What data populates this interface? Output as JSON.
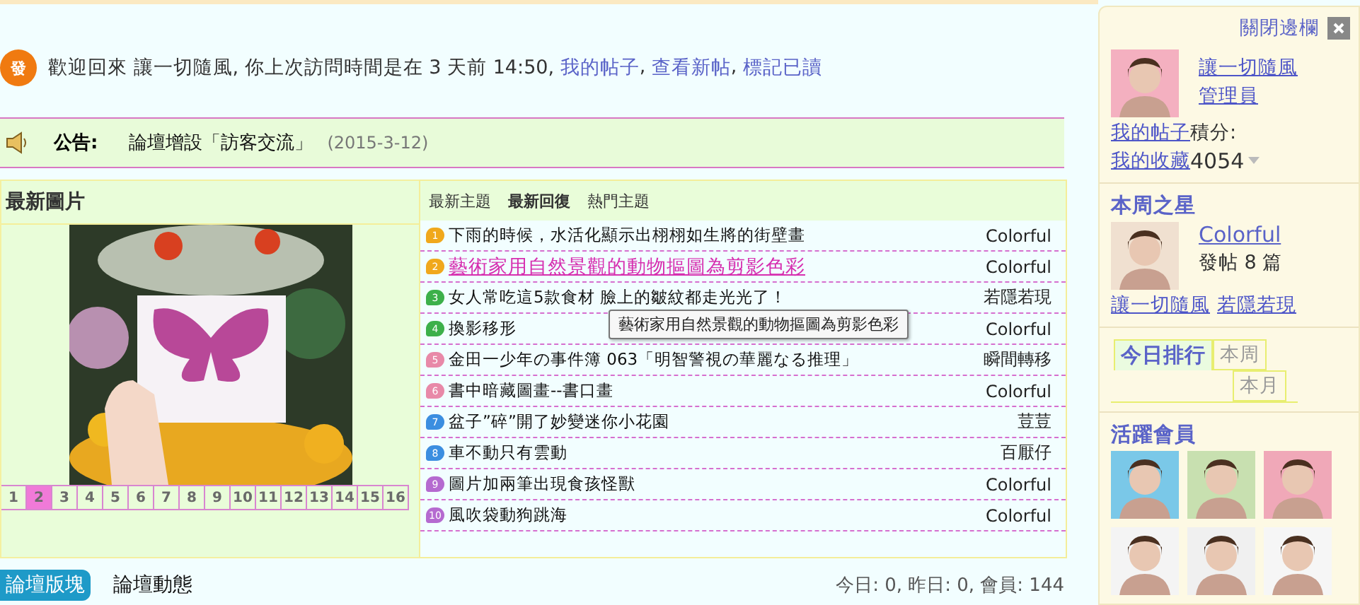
{
  "welcome": {
    "badge": "發",
    "text": "歡迎回來 讓一切隨風, 你上次訪問時間是在 3 天前 14:50, ",
    "links": [
      "我的帖子",
      "查看新帖",
      "標記已讀"
    ],
    "separator": ", "
  },
  "announcement": {
    "label": "公告:",
    "text": "論壇增設「訪客交流」",
    "date": "(2015-3-12)"
  },
  "latest_images": {
    "title": "最新圖片",
    "pages": [
      {
        "label": "1",
        "selected": false
      },
      {
        "label": "2",
        "selected": true
      },
      {
        "label": "3",
        "selected": false
      },
      {
        "label": "4",
        "selected": false
      },
      {
        "label": "5",
        "selected": false
      },
      {
        "label": "6",
        "selected": false
      },
      {
        "label": "7",
        "selected": false
      },
      {
        "label": "8",
        "selected": false
      },
      {
        "label": "9",
        "selected": false
      },
      {
        "label": "10",
        "selected": false
      },
      {
        "label": "11",
        "selected": false
      },
      {
        "label": "12",
        "selected": false
      },
      {
        "label": "13",
        "selected": false
      },
      {
        "label": "14",
        "selected": false
      },
      {
        "label": "15",
        "selected": false
      },
      {
        "label": "16",
        "selected": false
      }
    ]
  },
  "topics": {
    "tabs": [
      {
        "label": "最新主題",
        "selected": false
      },
      {
        "label": "最新回復",
        "selected": true
      },
      {
        "label": "熱門主題",
        "selected": false
      }
    ],
    "rows": [
      {
        "rank": "1",
        "color": "#f0a81c",
        "title": "下雨的時候，水活化顯示出栩栩如生將的街壁畫",
        "author": "Colorful",
        "highlighted": false
      },
      {
        "rank": "2",
        "color": "#f0a81c",
        "title": "藝術家用自然景觀的動物摳圖為剪影色彩",
        "author": "Colorful",
        "highlighted": true
      },
      {
        "rank": "3",
        "color": "#3cb04a",
        "title": "女人常吃這5款食材 臉上的皺紋都走光光了！",
        "author": "若隱若現",
        "highlighted": false
      },
      {
        "rank": "4",
        "color": "#3cb04a",
        "title": "換影移形",
        "author": "Colorful",
        "highlighted": false
      },
      {
        "rank": "5",
        "color": "#e889a8",
        "title": "金田一少年の事件簿 063「明智警視の華麗なる推理」",
        "author": "瞬間轉移",
        "highlighted": false
      },
      {
        "rank": "6",
        "color": "#e889a8",
        "title": "書中暗藏圖畫--書口畫",
        "author": "Colorful",
        "highlighted": false
      },
      {
        "rank": "7",
        "color": "#3b8ee0",
        "title": "盆子”碎”開了妙變迷你小花園",
        "author": "荳荳",
        "highlighted": false
      },
      {
        "rank": "8",
        "color": "#3b8ee0",
        "title": "車不動只有雲動",
        "author": "百厭仔",
        "highlighted": false
      },
      {
        "rank": "9",
        "color": "#b56ad0",
        "title": "圖片加兩筆出現食孩怪獸",
        "author": "Colorful",
        "highlighted": false
      },
      {
        "rank": "10",
        "color": "#b56ad0",
        "title": "風吹袋動狗跳海",
        "author": "Colorful",
        "highlighted": false
      }
    ],
    "tooltip": "藝術家用自然景觀的動物摳圖為剪影色彩"
  },
  "bottom_bar": {
    "tabs": [
      {
        "label": "論壇版塊",
        "selected": true
      },
      {
        "label": "論壇動態",
        "selected": false
      }
    ],
    "stats": "今日: 0, 昨日: 0, 會員: 144"
  },
  "sidebar": {
    "close_label": "關閉邊欄",
    "profile": {
      "name": "讓一切隨風",
      "role": "管理員",
      "links": [
        "我的帖子",
        "我的收藏"
      ],
      "points_label": "積分:",
      "points": "4054"
    },
    "star": {
      "title": "本周之星",
      "name": "Colorful",
      "posts": "發帖 8 篇",
      "links": [
        "讓一切隨風",
        "若隱若現"
      ]
    },
    "ranking_tabs": [
      {
        "label": "今日排行",
        "selected": true
      },
      {
        "label": "本周",
        "selected": false
      },
      {
        "label": "本月",
        "selected": false
      }
    ],
    "active": {
      "title": "活躍會員"
    }
  }
}
